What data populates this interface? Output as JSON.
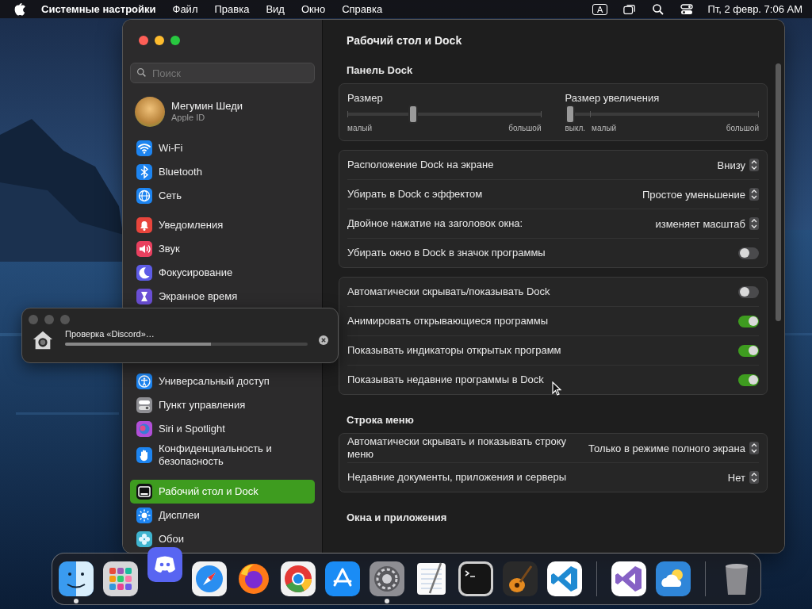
{
  "menu_bar": {
    "app_name": "Системные настройки",
    "menus": [
      "Файл",
      "Правка",
      "Вид",
      "Окно",
      "Справка"
    ],
    "input_source": "A",
    "datetime": "Пт, 2 февр. 7:06 AM"
  },
  "sidebar": {
    "search": {
      "placeholder": "Поиск"
    },
    "profile": {
      "name": "Мегумин Шеди",
      "subtitle": "Apple ID"
    },
    "groups": [
      {
        "items": [
          {
            "label": "Wi-Fi",
            "kind": "wifi",
            "color": "#1d84f0",
            "selected": false
          },
          {
            "label": "Bluetooth",
            "kind": "bluetooth",
            "color": "#1d84f0",
            "selected": false
          },
          {
            "label": "Сеть",
            "kind": "globe",
            "color": "#1d84f0",
            "selected": false
          }
        ]
      },
      {
        "items": [
          {
            "label": "Уведомления",
            "kind": "bell",
            "color": "#e8453c",
            "selected": false
          },
          {
            "label": "Звук",
            "kind": "speaker",
            "color": "#e9405f",
            "selected": false
          },
          {
            "label": "Фокусирование",
            "kind": "moon",
            "color": "#5e5ce6",
            "selected": false
          },
          {
            "label": "Экранное время",
            "kind": "hourglass",
            "color": "#6b4fd6",
            "selected": false
          }
        ]
      },
      {
        "items": [
          {
            "label": "Универсальный доступ",
            "kind": "person",
            "color": "#1d84f0",
            "selected": false
          },
          {
            "label": "Пункт управления",
            "kind": "toggles",
            "color": "#8e8e93",
            "selected": false
          },
          {
            "label": "Siri и Spotlight",
            "kind": "orb",
            "color": "#b14fd8",
            "selected": false
          },
          {
            "label": "Конфиденциальность и безопасность",
            "kind": "hand",
            "color": "#1d84f0",
            "selected": false
          }
        ]
      },
      {
        "items": [
          {
            "label": "Рабочий стол и Dock",
            "kind": "dock",
            "color": "#111113",
            "selected": true
          },
          {
            "label": "Дисплеи",
            "kind": "sun",
            "color": "#1d84f0",
            "selected": false
          },
          {
            "label": "Обои",
            "kind": "flower",
            "color": "#3fb4cf",
            "selected": false
          }
        ]
      }
    ]
  },
  "content": {
    "title": "Рабочий стол и Dock",
    "sections": [
      {
        "heading": "Панель Dock",
        "cards": [
          {
            "kind": "sliders",
            "sliders": [
              {
                "label": "Размер",
                "level": 0.33,
                "scale_labels": [
                  "малый",
                  "большой"
                ]
              },
              {
                "label": "Размер увеличения",
                "level": 0,
                "scale_labels": [
                  "выкл.",
                  "малый",
                  "большой"
                ]
              }
            ]
          },
          {
            "kind": "rows",
            "rows": [
              {
                "kind": "popup",
                "label": "Расположение Dock на экране",
                "value": "Внизу"
              },
              {
                "kind": "popup",
                "label": "Убирать в Dock с эффектом",
                "value": "Простое уменьшение"
              },
              {
                "kind": "popup",
                "label": "Двойное нажатие на заголовок окна:",
                "value": "изменяет масштаб"
              },
              {
                "kind": "toggle",
                "label": "Убирать окно в Dock в значок программы",
                "on": false
              }
            ]
          },
          {
            "kind": "rows",
            "rows": [
              {
                "kind": "toggle",
                "label": "Автоматически скрывать/показывать Dock",
                "on": false
              },
              {
                "kind": "toggle",
                "label": "Анимировать открывающиеся программы",
                "on": true
              },
              {
                "kind": "toggle",
                "label": "Показывать индикаторы открытых программ",
                "on": true
              },
              {
                "kind": "toggle",
                "label": "Показывать недавние программы в Dock",
                "on": true
              }
            ]
          }
        ]
      },
      {
        "heading": "Строка меню",
        "cards": [
          {
            "kind": "rows",
            "rows": [
              {
                "kind": "popup",
                "label": "Автоматически скрывать и показывать строку меню",
                "value": "Только в режиме полного экрана"
              },
              {
                "kind": "popup",
                "label": "Недавние документы, приложения и серверы",
                "value": "Нет"
              }
            ]
          }
        ]
      },
      {
        "heading": "Окна и приложения"
      }
    ]
  },
  "dialog": {
    "title": "Проверка «Discord»…",
    "level": 0.6
  },
  "dock": {
    "items": [
      {
        "kind": "finder",
        "running": true
      },
      {
        "kind": "launchpad",
        "running": false
      },
      {
        "kind": "discord",
        "running": false
      },
      {
        "kind": "safari",
        "running": false
      },
      {
        "kind": "firefox",
        "running": false
      },
      {
        "kind": "chrome",
        "running": false
      },
      {
        "kind": "appstore",
        "running": false
      },
      {
        "kind": "settings",
        "running": true
      },
      {
        "kind": "textedit",
        "running": false
      },
      {
        "kind": "terminal",
        "running": false
      },
      {
        "kind": "garageband",
        "running": false
      },
      {
        "kind": "vscode",
        "running": false
      },
      {
        "kind": "separator"
      },
      {
        "kind": "visualstudio",
        "running": false
      },
      {
        "kind": "weather",
        "running": false
      },
      {
        "kind": "separator"
      },
      {
        "kind": "trash",
        "running": false
      }
    ]
  }
}
